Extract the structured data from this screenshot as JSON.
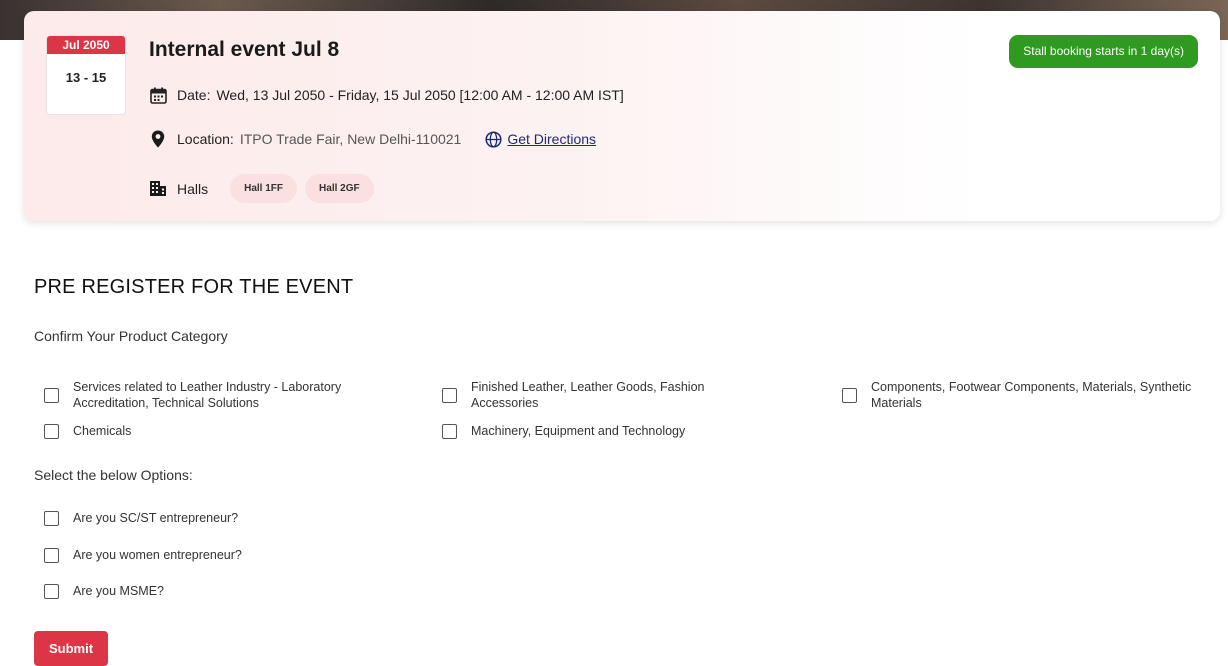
{
  "event": {
    "badge_month": "Jul 2050",
    "badge_days": "13 - 15",
    "title": "Internal event Jul 8",
    "stall_status": "Stall booking starts in 1 day(s)",
    "date_label": "Date:",
    "date_value": "Wed, 13 Jul 2050 - Friday, 15 Jul 2050 [12:00 AM - 12:00 AM IST]",
    "location_label": "Location:",
    "location_value": "ITPO Trade Fair, New Delhi-110021",
    "directions_label": "Get Directions",
    "halls_label": "Halls",
    "halls": [
      "Hall 1FF",
      "Hall 2GF"
    ]
  },
  "form": {
    "title": "PRE REGISTER FOR THE EVENT",
    "category_label": "Confirm Your Product Category",
    "categories": [
      "Services related to Leather Industry - Laboratory Accreditation, Technical Solutions",
      "Finished Leather, Leather Goods, Fashion Accessories",
      "Components, Footwear Components, Materials, Synthetic Materials",
      "Chemicals",
      "Machinery, Equipment and Technology"
    ],
    "options_label": "Select the below Options:",
    "options": [
      "Are you SC/ST entrepreneur?",
      "Are you women entrepreneur?",
      "Are you MSME?"
    ],
    "submit_label": "Submit"
  },
  "colors": {
    "accent_red": "#dc3545",
    "status_green": "#2e9a1f",
    "link_navy": "#1c2b6e"
  },
  "icons": {
    "date": "calendar-icon",
    "location": "map-pin-icon",
    "directions": "globe-icon",
    "halls": "building-icon"
  }
}
